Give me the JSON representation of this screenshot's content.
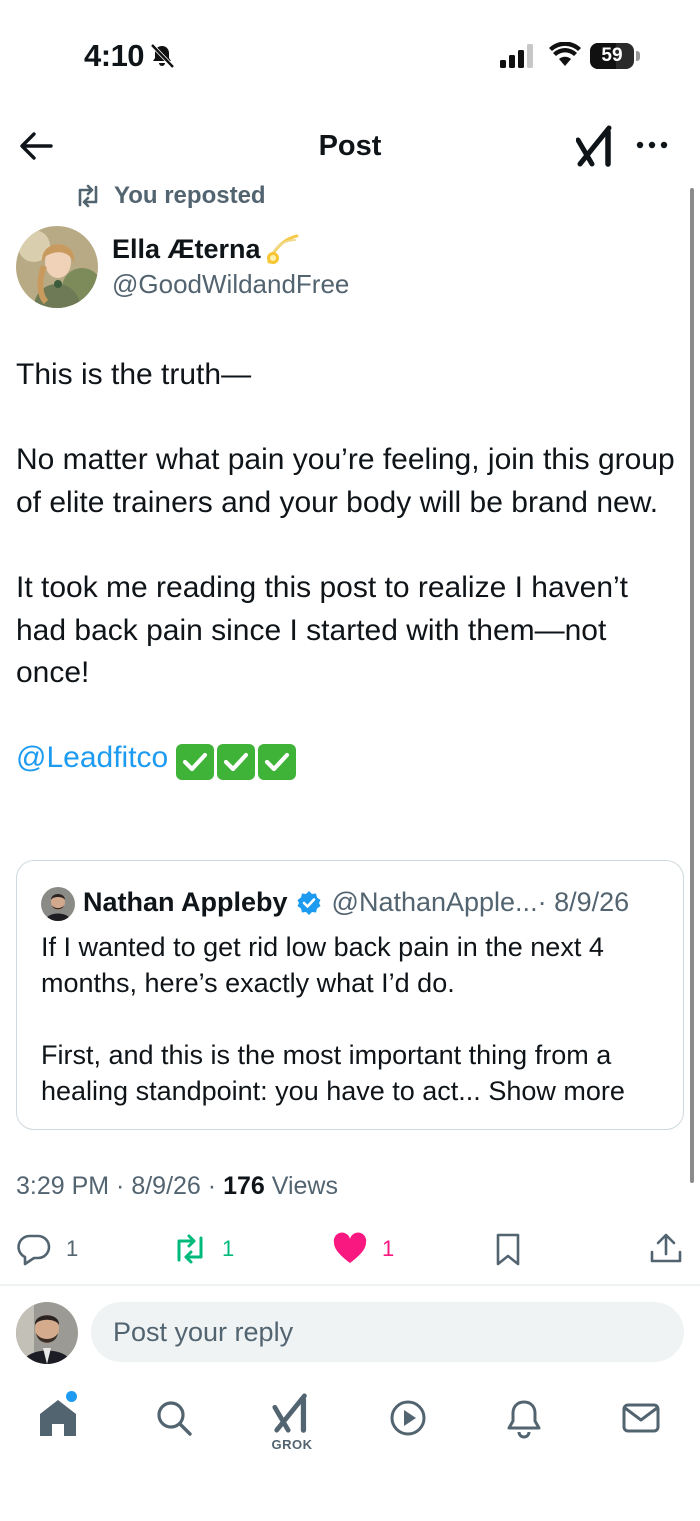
{
  "status_bar": {
    "time": "4:10",
    "battery": "59",
    "battery_fraction": 0.59
  },
  "header": {
    "title": "Post"
  },
  "repost": {
    "label": "You reposted"
  },
  "post": {
    "author_name": "Ella Æterna",
    "author_handle": "@GoodWildandFree",
    "paragraphs": [
      "This is the truth—",
      "No matter what pain you’re feeling, join this group of elite trainers and your body will be brand new.",
      "It took me reading this post to realize I haven’t had back pain since I started with them—not once!"
    ],
    "mention": "@Leadfitco",
    "check_count": 3
  },
  "quote": {
    "name": "Nathan Appleby",
    "handle": "@NathanApple...",
    "date": "· 8/9/26",
    "paragraph1": "If I wanted to get rid low back pain in the next 4 months, here’s exactly what I’d do.",
    "paragraph2": "First, and this is the most important thing from a healing standpoint: you have to act...",
    "show_more": "Show more"
  },
  "meta": {
    "time": "3:29 PM",
    "date": "8/9/26",
    "views_count": "176",
    "views_label": "Views"
  },
  "actions": {
    "replies": "1",
    "reposts": "1",
    "likes": "1"
  },
  "reply": {
    "placeholder": "Post your reply"
  },
  "tabbar": {
    "grok_label": "GROK"
  },
  "colors": {
    "accent": "#1d9bf0",
    "repost_green": "#00ba7c",
    "like_pink": "#f91880",
    "muted": "#536471"
  }
}
